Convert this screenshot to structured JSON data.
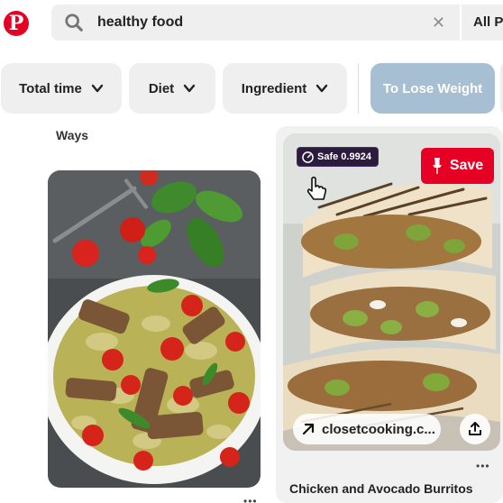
{
  "header": {
    "logo_glyph": "P",
    "search_query": "healthy food",
    "clear_glyph": "✕",
    "scope_label": "All Pi"
  },
  "filters": [
    {
      "label": "Total time"
    },
    {
      "label": "Diet"
    },
    {
      "label": "Ingredient"
    },
    {
      "label": "To Lose Weight"
    }
  ],
  "pins": {
    "left": {
      "title_fragment": "Ways",
      "dots": "•••",
      "image": "pasta-salad-with-grilled-chicken-photo"
    },
    "right": {
      "safe_badge": "Safe 0.9924",
      "save_label": "Save",
      "link_text": "closetcooking.c...",
      "dots": "•••",
      "title": "Chicken and Avocado Burritos",
      "image": "chicken-avocado-burritos-photo"
    }
  },
  "colors": {
    "brand": "#e60023",
    "chip_bg": "#efefef",
    "chip_active": "#a7bfd2",
    "badge_bg": "#2b1b3d"
  }
}
